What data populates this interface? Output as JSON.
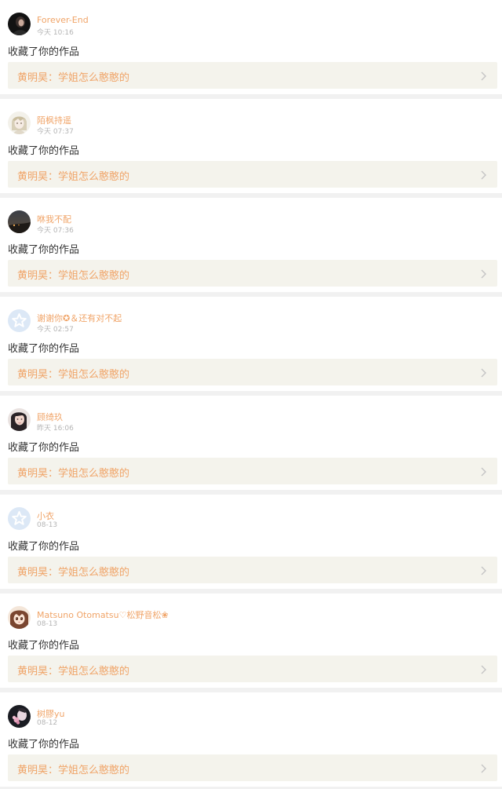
{
  "notifications": [
    {
      "username": "Forever-End",
      "time": "今天 10:16",
      "action": "收藏了你的作品",
      "work_title": "黄明昊：学姐怎么憨憨的",
      "avatar": "dark-portrait-avatar"
    },
    {
      "username": "陌枫持遥",
      "time": "今天 07:37",
      "action": "收藏了你的作品",
      "work_title": "黄明昊：学姐怎么憨憨的",
      "avatar": "anime-character-avatar"
    },
    {
      "username": "咻我不配",
      "time": "今天 07:36",
      "action": "收藏了你的作品",
      "work_title": "黄明昊：学姐怎么憨憨的",
      "avatar": "night-landscape-avatar"
    },
    {
      "username": "谢谢你✪＆还有对不起",
      "time": "今天 02:57",
      "action": "收藏了你的作品",
      "work_title": "黄明昊：学姐怎么憨憨的",
      "avatar": "default-star-avatar"
    },
    {
      "username": "顾绮玖",
      "time": "昨天 16:06",
      "action": "收藏了你的作品",
      "work_title": "黄明昊：学姐怎么憨憨的",
      "avatar": "girl-portrait-avatar"
    },
    {
      "username": "小衣",
      "time": "08-13",
      "action": "收藏了你的作品",
      "work_title": "黄明昊：学姐怎么憨憨的",
      "avatar": "default-star-avatar"
    },
    {
      "username": "Matsuno Otomatsu♡松野音松❀",
      "time": "08-13",
      "action": "收藏了你的作品",
      "work_title": "黄明昊：学姐怎么憨憨的",
      "avatar": "anime-girl-avatar"
    },
    {
      "username": "树膠yu",
      "time": "08-12",
      "action": "收藏了你的作品",
      "work_title": "黄明昊：学姐怎么憨憨的",
      "avatar": "pink-flower-avatar"
    }
  ],
  "colors": {
    "accent": "#f0a468",
    "card_bg": "#ffffff",
    "work_bg": "#f4f3ec",
    "separator": "#f1f1f1",
    "time_text": "#b4b4b4",
    "body_text": "#333333",
    "default_avatar_bg": "#dce8f6"
  },
  "icons": {
    "chevron": "chevron-right-icon",
    "default_avatar": "star-icon"
  }
}
